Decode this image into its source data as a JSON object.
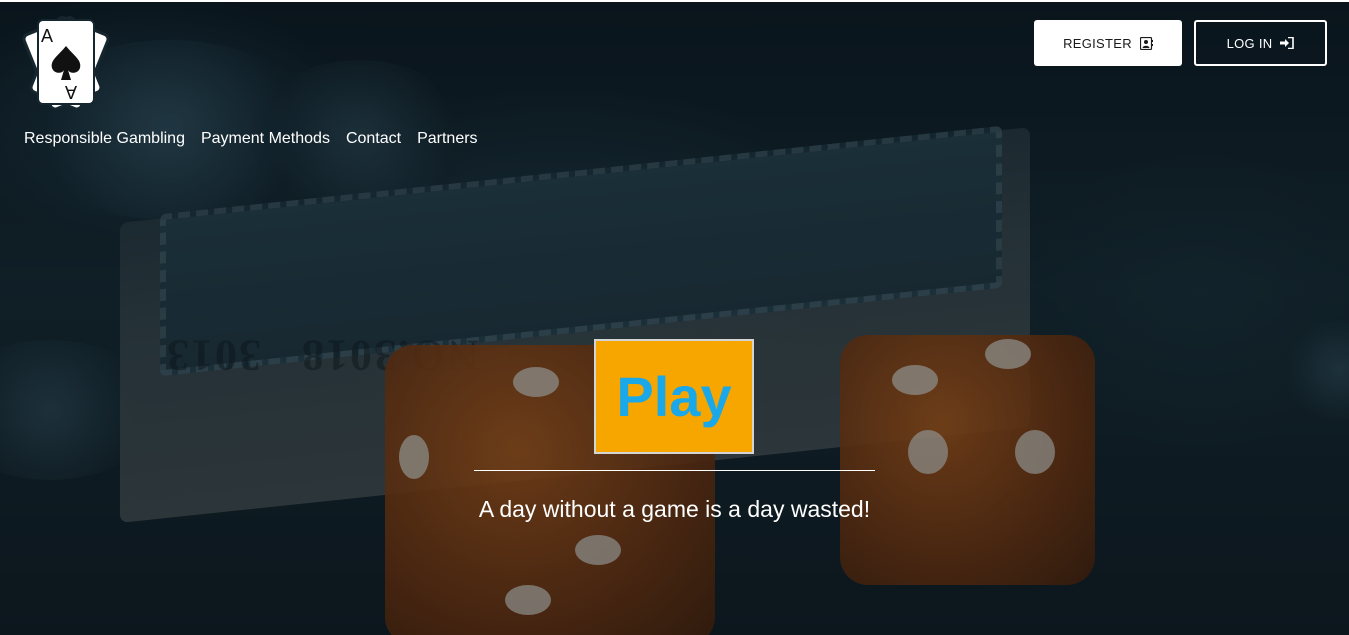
{
  "header": {
    "register_label": "REGISTER",
    "login_label": "LOG IN"
  },
  "nav": {
    "items": [
      {
        "label": "Responsible Gambling"
      },
      {
        "label": "Payment Methods"
      },
      {
        "label": "Contact"
      },
      {
        "label": "Partners"
      }
    ]
  },
  "hero": {
    "play_label": "Play",
    "tagline": "A day without a game is a day wasted!"
  },
  "logo": {
    "card_rank": "A",
    "icon": "spade-card-icon"
  },
  "colors": {
    "play_button_bg": "#f7a600",
    "play_button_text": "#1aa8e8",
    "register_bg": "#ffffff",
    "text_light": "#ffffff"
  }
}
